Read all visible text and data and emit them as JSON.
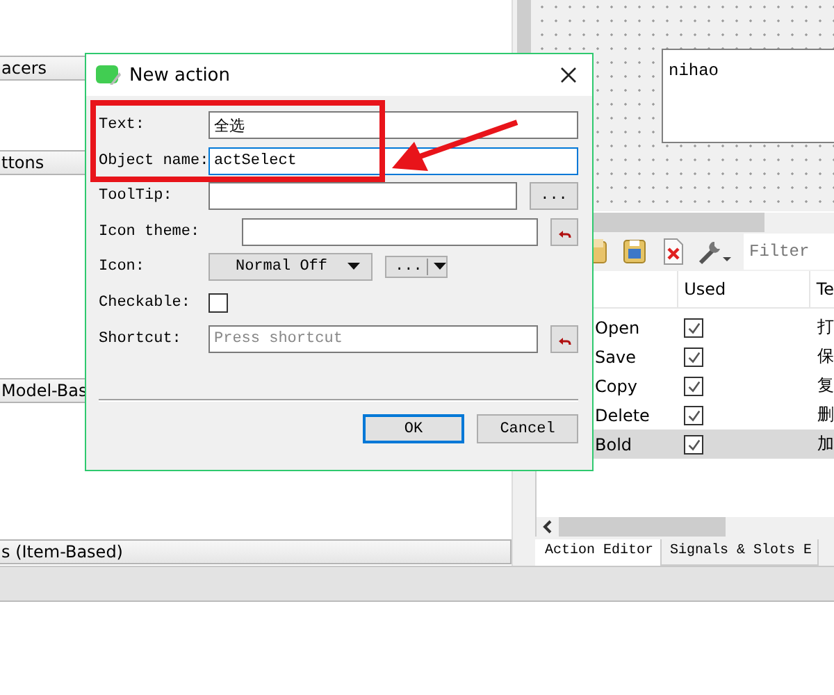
{
  "widget_box": {
    "sections": [
      {
        "title": "acers"
      },
      {
        "title": "ttons"
      },
      {
        "title": "Model-Bas"
      },
      {
        "title": "s (Item-Based)"
      }
    ]
  },
  "form_preview": {
    "label": "nihao"
  },
  "action_editor": {
    "filter": {
      "placeholder": "Filter"
    },
    "columns": [
      "Used",
      "Te"
    ],
    "rows": [
      {
        "name": "Open",
        "used": true,
        "text": "打",
        "selected": false
      },
      {
        "name": "Save",
        "used": true,
        "text": "保",
        "selected": false
      },
      {
        "name": "Copy",
        "used": true,
        "text": "复",
        "selected": false
      },
      {
        "name": "Delete",
        "used": true,
        "text": "删",
        "selected": false
      },
      {
        "name": "Bold",
        "used": true,
        "text": "加",
        "selected": true
      }
    ],
    "tabs": [
      {
        "label": "Action Editor",
        "selected": true
      },
      {
        "label": "Signals & Slots E",
        "selected": false
      }
    ]
  },
  "dialog": {
    "title": "New action",
    "fields": [
      {
        "kind": "text",
        "label": "Text:",
        "value": "全选",
        "focused": false
      },
      {
        "kind": "text",
        "label": "Object name:",
        "value": "actSelect",
        "focused": true
      },
      {
        "kind": "more",
        "label": "ToolTip:",
        "focused": false,
        "button": "..."
      },
      {
        "kind": "reset",
        "label": "Icon theme:",
        "focused": false
      },
      {
        "kind": "icon",
        "label": "Icon:",
        "mode": "Normal Off",
        "button": "..."
      },
      {
        "kind": "check",
        "label": "Checkable:",
        "checked": false
      },
      {
        "kind": "shortcut",
        "label": "Shortcut:",
        "placeholder": "Press shortcut"
      }
    ],
    "buttons": [
      {
        "label": "OK",
        "default": true
      },
      {
        "label": "Cancel",
        "default": false
      }
    ]
  }
}
